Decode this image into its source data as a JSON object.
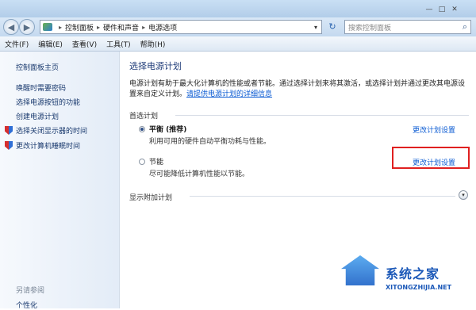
{
  "address_bar": {
    "segments": [
      "控制面板",
      "硬件和声音",
      "电源选项"
    ],
    "search_placeholder": "搜索控制面板"
  },
  "window_controls": [
    "—",
    "□",
    "✕"
  ],
  "menu": [
    "文件(F)",
    "编辑(E)",
    "查看(V)",
    "工具(T)",
    "帮助(H)"
  ],
  "sidebar": {
    "home": "控制面板主页",
    "links": [
      "唤醒时需要密码",
      "选择电源按钮的功能",
      "创建电源计划",
      "选择关闭显示器的时间",
      "更改计算机睡眠时间"
    ],
    "see_also": "另请参阅",
    "personalize": "个性化"
  },
  "main": {
    "title": "选择电源计划",
    "description": "电源计划有助于最大化计算机的性能或者节能。通过选择计划来将其激活，或选择计划并通过更改其电源设置来自定义计划。",
    "description_link": "请提供电源计划的详细信息",
    "preferred_header": "首选计划",
    "plans": [
      {
        "name": "平衡 (推荐)",
        "desc": "利用可用的硬件自动平衡功耗与性能。",
        "change": "更改计划设置",
        "selected": true
      },
      {
        "name": "节能",
        "desc": "尽可能降低计算机性能以节能。",
        "change": "更改计划设置",
        "selected": false
      }
    ],
    "more_plans": "显示附加计划"
  },
  "watermark": {
    "brand": "系统之家",
    "url": "XITONGZHIJIA.NET"
  },
  "colors": {
    "link": "#0b5bd3",
    "title": "#1e3b78",
    "highlight_box": "#e02020"
  }
}
